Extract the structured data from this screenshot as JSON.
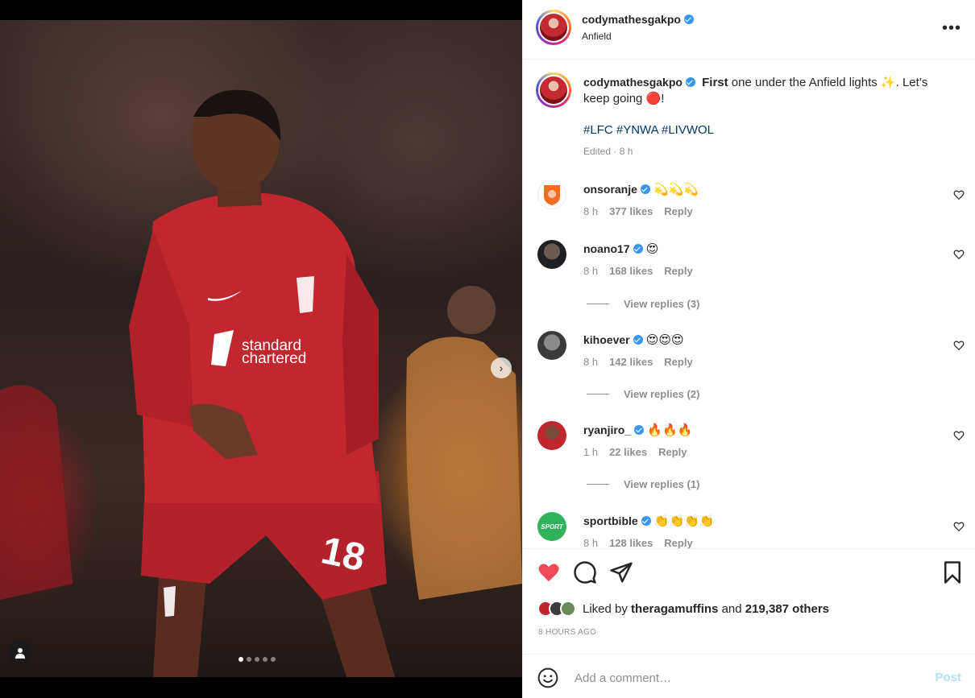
{
  "post": {
    "username": "codymathesgakpo",
    "location": "Anfield",
    "caption_bold": "First",
    "caption_rest": " one under the Anfield lights ✨. Let’s keep going 🔴!",
    "hashtags": "#LFC #YNWA #LIVWOL",
    "edited": "Edited · 8 h"
  },
  "media": {
    "next_icon": "chevron-right-icon",
    "tag_icon": "user-icon",
    "carousel_count": 5,
    "carousel_active": 1
  },
  "comments": [
    {
      "username": "onsoranje",
      "text": "💫💫💫",
      "time": "8 h",
      "likes": "377 likes",
      "reply": "Reply",
      "replies": ""
    },
    {
      "username": "noano17",
      "text": "😍",
      "time": "8 h",
      "likes": "168 likes",
      "reply": "Reply",
      "replies": "View replies (3)"
    },
    {
      "username": "kihoever",
      "text": "😍😍😍",
      "time": "8 h",
      "likes": "142 likes",
      "reply": "Reply",
      "replies": "View replies (2)"
    },
    {
      "username": "ryanjiro_",
      "text": "🔥🔥🔥",
      "time": "1 h",
      "likes": "22 likes",
      "reply": "Reply",
      "replies": "View replies (1)"
    },
    {
      "username": "sportbible",
      "text": "👏👏👏👏",
      "time": "8 h",
      "likes": "128 likes",
      "reply": "Reply",
      "replies": ""
    }
  ],
  "actions": {
    "liked_by_prefix": "Liked by ",
    "liked_by_user": "theragamuffins",
    "liked_by_mid": " and ",
    "liked_by_count": "219,387 others",
    "time_ago": "8 HOURS AGO"
  },
  "composer": {
    "placeholder": "Add a comment…",
    "post_label": "Post"
  },
  "colors": {
    "like_red": "#ed4956",
    "link_blue": "#00376b",
    "verified_blue": "#3897f0",
    "post_disabled": "#b2dffc"
  }
}
